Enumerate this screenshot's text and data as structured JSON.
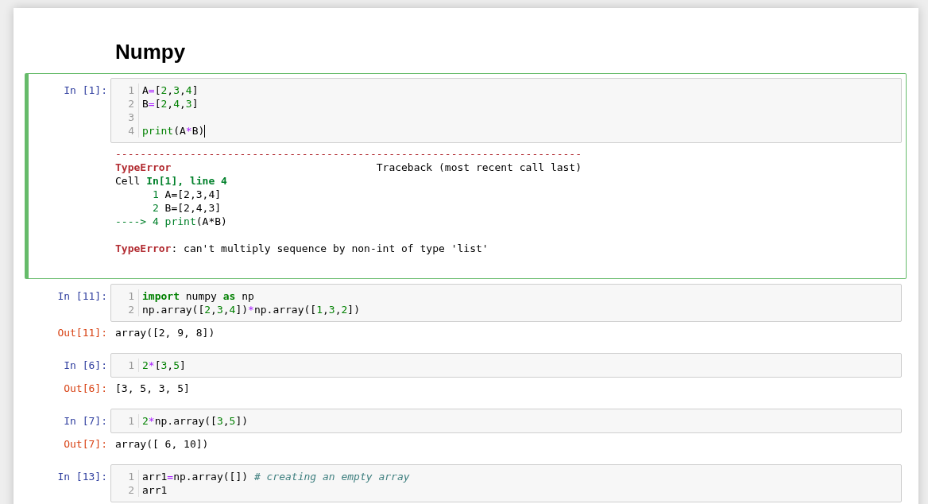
{
  "heading": "Numpy",
  "cells": [
    {
      "prompt": "In [1]:",
      "selected": true,
      "editing": true,
      "lines": [
        {
          "n": "1",
          "tokens": [
            {
              "kind": "plain",
              "text": "A"
            },
            {
              "kind": "op",
              "text": "="
            },
            {
              "kind": "plain",
              "text": "["
            },
            {
              "kind": "num",
              "text": "2"
            },
            {
              "kind": "plain",
              "text": ","
            },
            {
              "kind": "num",
              "text": "3"
            },
            {
              "kind": "plain",
              "text": ","
            },
            {
              "kind": "num",
              "text": "4"
            },
            {
              "kind": "plain",
              "text": "]"
            }
          ]
        },
        {
          "n": "2",
          "tokens": [
            {
              "kind": "plain",
              "text": "B"
            },
            {
              "kind": "op",
              "text": "="
            },
            {
              "kind": "plain",
              "text": "["
            },
            {
              "kind": "num",
              "text": "2"
            },
            {
              "kind": "plain",
              "text": ","
            },
            {
              "kind": "num",
              "text": "4"
            },
            {
              "kind": "plain",
              "text": ","
            },
            {
              "kind": "num",
              "text": "3"
            },
            {
              "kind": "plain",
              "text": "]"
            }
          ]
        },
        {
          "n": "3"
        },
        {
          "n": "4",
          "tokens": [
            {
              "kind": "builtin",
              "text": "print"
            },
            {
              "kind": "plain",
              "text": "(A"
            },
            {
              "kind": "op",
              "text": "*"
            },
            {
              "kind": "plain",
              "text": "B)"
            }
          ]
        }
      ],
      "output": {
        "kind": "error",
        "lines": [
          {
            "tokens": [
              {
                "kind": "rule",
                "text": "---------------------------------------------------------------------------"
              }
            ]
          },
          {
            "tokens": [
              {
                "kind": "err",
                "text": "TypeError"
              },
              {
                "kind": "plain",
                "text": "                                 Traceback (most recent call last)"
              }
            ]
          },
          {
            "tokens": [
              {
                "kind": "plain",
                "text": "Cell "
              },
              {
                "kind": "loc",
                "text": "In[1], line 4"
              }
            ]
          },
          {
            "tokens": [
              {
                "kind": "green",
                "text": "      1"
              },
              {
                "kind": "plain",
                "text": " A=[2,3,4]"
              }
            ]
          },
          {
            "tokens": [
              {
                "kind": "green",
                "text": "      2"
              },
              {
                "kind": "plain",
                "text": " B=[2,4,3]"
              }
            ]
          },
          {
            "tokens": [
              {
                "kind": "green",
                "text": "----> 4 print"
              },
              {
                "kind": "plain",
                "text": "(A*B)"
              }
            ]
          }
        ],
        "message": {
          "tokens": [
            {
              "kind": "err",
              "text": "TypeError"
            },
            {
              "kind": "plain",
              "text": ": can't multiply sequence by non-int of type 'list'"
            }
          ]
        }
      }
    },
    {
      "prompt": "In [11]:",
      "selected": false,
      "editing": false,
      "lines": [
        {
          "n": "1",
          "tokens": [
            {
              "kind": "kw",
              "text": "import"
            },
            {
              "kind": "plain",
              "text": " numpy "
            },
            {
              "kind": "kw",
              "text": "as"
            },
            {
              "kind": "plain",
              "text": " np"
            }
          ]
        },
        {
          "n": "2",
          "tokens": [
            {
              "kind": "plain",
              "text": "np.array(["
            },
            {
              "kind": "num",
              "text": "2"
            },
            {
              "kind": "plain",
              "text": ","
            },
            {
              "kind": "num",
              "text": "3"
            },
            {
              "kind": "plain",
              "text": ","
            },
            {
              "kind": "num",
              "text": "4"
            },
            {
              "kind": "plain",
              "text": "])"
            },
            {
              "kind": "op",
              "text": "*"
            },
            {
              "kind": "plain",
              "text": "np.array(["
            },
            {
              "kind": "num",
              "text": "1"
            },
            {
              "kind": "plain",
              "text": ","
            },
            {
              "kind": "num",
              "text": "3"
            },
            {
              "kind": "plain",
              "text": ","
            },
            {
              "kind": "num",
              "text": "2"
            },
            {
              "kind": "plain",
              "text": "])"
            }
          ]
        }
      ],
      "output": {
        "kind": "result",
        "prompt": "Out[11]:",
        "text": "array([2, 9, 8])"
      }
    },
    {
      "prompt": "In [6]:",
      "selected": false,
      "editing": false,
      "lines": [
        {
          "n": "1",
          "tokens": [
            {
              "kind": "num",
              "text": "2"
            },
            {
              "kind": "op",
              "text": "*"
            },
            {
              "kind": "plain",
              "text": "["
            },
            {
              "kind": "num",
              "text": "3"
            },
            {
              "kind": "plain",
              "text": ","
            },
            {
              "kind": "num",
              "text": "5"
            },
            {
              "kind": "plain",
              "text": "]"
            }
          ]
        }
      ],
      "output": {
        "kind": "result",
        "prompt": "Out[6]:",
        "text": "[3, 5, 3, 5]"
      }
    },
    {
      "prompt": "In [7]:",
      "selected": false,
      "editing": false,
      "lines": [
        {
          "n": "1",
          "tokens": [
            {
              "kind": "num",
              "text": "2"
            },
            {
              "kind": "op",
              "text": "*"
            },
            {
              "kind": "plain",
              "text": "np.array(["
            },
            {
              "kind": "num",
              "text": "3"
            },
            {
              "kind": "plain",
              "text": ","
            },
            {
              "kind": "num",
              "text": "5"
            },
            {
              "kind": "plain",
              "text": "])"
            }
          ]
        }
      ],
      "output": {
        "kind": "result",
        "prompt": "Out[7]:",
        "text": "array([ 6, 10])"
      }
    },
    {
      "prompt": "In [13]:",
      "selected": false,
      "editing": false,
      "lines": [
        {
          "n": "1",
          "tokens": [
            {
              "kind": "plain",
              "text": "arr1"
            },
            {
              "kind": "op",
              "text": "="
            },
            {
              "kind": "plain",
              "text": "np.array([]) "
            },
            {
              "kind": "comment",
              "text": "# creating an empty array"
            }
          ]
        },
        {
          "n": "2",
          "tokens": [
            {
              "kind": "plain",
              "text": "arr1"
            }
          ]
        }
      ]
    }
  ]
}
